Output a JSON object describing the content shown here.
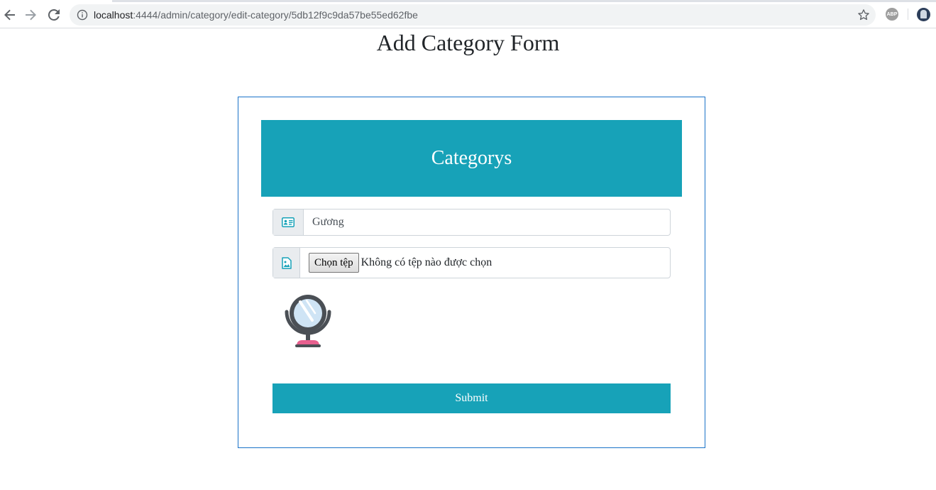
{
  "browser": {
    "url_host": "localhost",
    "url_rest": ":4444/admin/category/edit-category/5db12f9c9da57be55ed62fbe",
    "extension_label": "ABP"
  },
  "page": {
    "title": "Add Category Form"
  },
  "form": {
    "header": "Categorys",
    "name_value": "Gương",
    "file_button_label": "Chọn tệp",
    "file_status": "Không có tệp nào được chọn",
    "preview_icon": "mirror-icon",
    "submit_label": "Submit"
  },
  "colors": {
    "accent": "#17a2b8",
    "card_border": "#1a73c8"
  }
}
